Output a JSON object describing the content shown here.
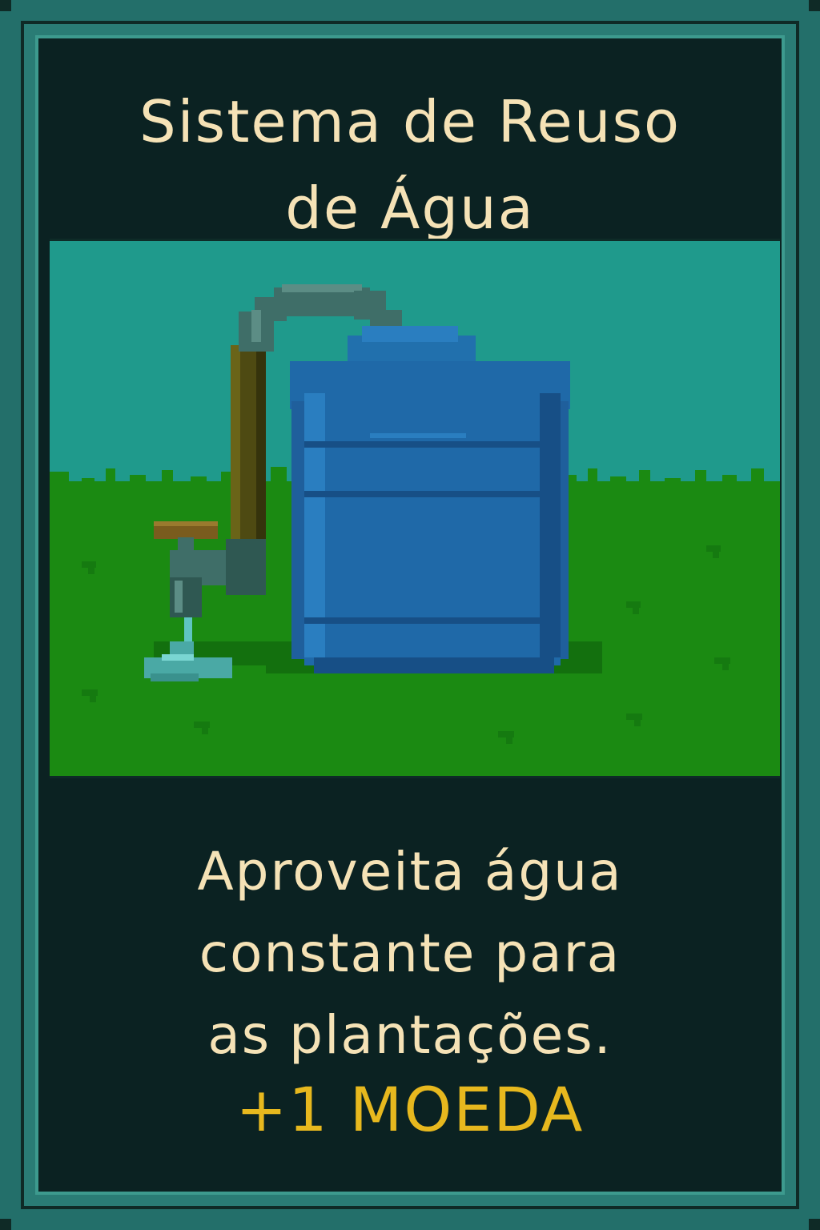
{
  "card": {
    "title_lines": [
      "Sistema de Reuso",
      "de Água"
    ],
    "description_lines": [
      "Aproveita água",
      "constante para",
      "as plantações."
    ],
    "reward": "+1 MOEDA"
  },
  "illustration": {
    "subject": "water-tank-icon",
    "elements": [
      "water-tank-icon",
      "pipe-icon",
      "faucet-icon",
      "water-puddle-icon",
      "grass-field"
    ]
  },
  "colors": {
    "frame": "#236f6a",
    "panel": "#0b2222",
    "text": "#f5e2b6",
    "reward": "#e7b81e",
    "sky": "#1f9a8c",
    "grass": "#1b8a12",
    "tank": "#1f69a8"
  }
}
